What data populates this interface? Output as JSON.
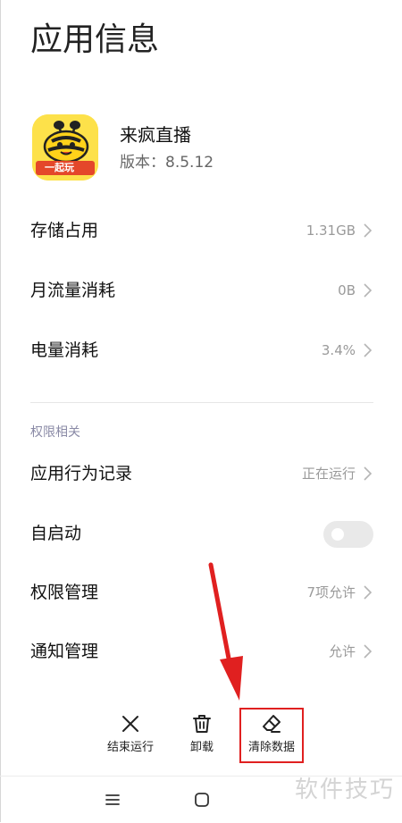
{
  "page": {
    "title": "应用信息"
  },
  "app": {
    "name": "来疯直播",
    "version_label": "版本：",
    "version": "8.5.12",
    "icon_badge_text": "一起玩"
  },
  "stats": [
    {
      "label": "存储占用",
      "value": "1.31GB"
    },
    {
      "label": "月流量消耗",
      "value": "0B"
    },
    {
      "label": "电量消耗",
      "value": "3.4%"
    }
  ],
  "permissions": {
    "section_label": "权限相关",
    "items": [
      {
        "label": "应用行为记录",
        "value": "正在运行"
      },
      {
        "label": "自启动",
        "toggle_on": false
      },
      {
        "label": "权限管理",
        "value": "7项允许"
      },
      {
        "label": "通知管理",
        "value": "允许"
      }
    ]
  },
  "actions": [
    {
      "label": "结束运行",
      "icon": "close-icon"
    },
    {
      "label": "卸载",
      "icon": "trash-icon"
    },
    {
      "label": "清除数据",
      "icon": "eraser-icon"
    }
  ],
  "annotation": {
    "color": "#e02020"
  },
  "navbar": {
    "buttons": [
      "menu-icon",
      "home-icon"
    ]
  },
  "watermark": "软件技巧"
}
